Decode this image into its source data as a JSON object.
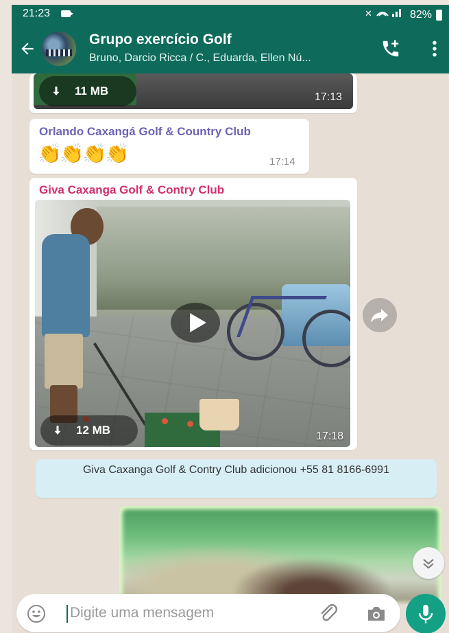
{
  "status_bar": {
    "time": "21:23",
    "battery": "82%"
  },
  "header": {
    "title": "Grupo exercício Golf",
    "subtitle": "Bruno, Darcio Ricca / C., Eduarda, Ellen Nú..."
  },
  "messages": [
    {
      "type": "media",
      "size": "11 MB",
      "time": "17:13"
    },
    {
      "type": "text",
      "sender": "Orlando Caxangá Golf & Country Club",
      "sender_color": "#6b63b5",
      "text": "👏👏👏👏",
      "time": "17:14"
    },
    {
      "type": "video",
      "sender": "Giva Caxanga Golf & Contry Club",
      "sender_color": "#d1306d",
      "size": "12 MB",
      "time": "17:18"
    }
  ],
  "system_message": "Giva Caxanga Golf & Contry Club adicionou +55 81 8166-6991",
  "composer": {
    "placeholder": "Digite uma mensagem"
  },
  "colors": {
    "header": "#0e6b5c",
    "accent": "#13a085",
    "outgoing_bubble": "#dcf8c6",
    "system_bubble": "#d8eef5"
  },
  "icons": [
    "back-arrow-icon",
    "add-call-icon",
    "more-vert-icon",
    "download-icon",
    "play-icon",
    "forward-icon",
    "scroll-down-icon",
    "emoji-icon",
    "attach-icon",
    "camera-icon",
    "mic-icon"
  ]
}
